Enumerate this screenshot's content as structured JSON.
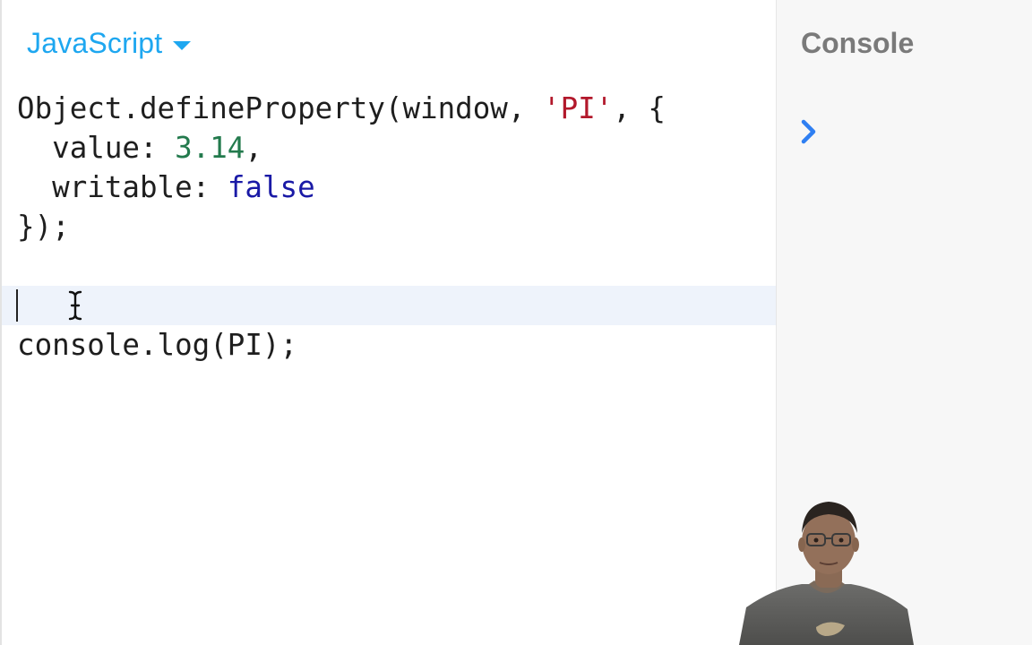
{
  "editor": {
    "language": "JavaScript",
    "lines": [
      [
        {
          "t": "Object.defineProperty(window, "
        },
        {
          "t": "'PI'",
          "c": "string"
        },
        {
          "t": ", {"
        }
      ],
      [
        {
          "t": "  value: "
        },
        {
          "t": "3.14",
          "c": "number"
        },
        {
          "t": ","
        }
      ],
      [
        {
          "t": "  writable: "
        },
        {
          "t": "false",
          "c": "keyword"
        }
      ],
      [
        {
          "t": "});"
        }
      ],
      [],
      [],
      [
        {
          "t": "console.log(PI);"
        }
      ]
    ],
    "active_line": 5
  },
  "console": {
    "title": "Console",
    "prompt_icon": "chevron-right-icon"
  },
  "colors": {
    "accent": "#1ea7f0",
    "string": "#b2182b",
    "number": "#237a4d",
    "keyword": "#1a1aa6",
    "active_line": "#eef3fb",
    "console_bg": "#f7f7f7",
    "prompt": "#2f7ff2"
  }
}
